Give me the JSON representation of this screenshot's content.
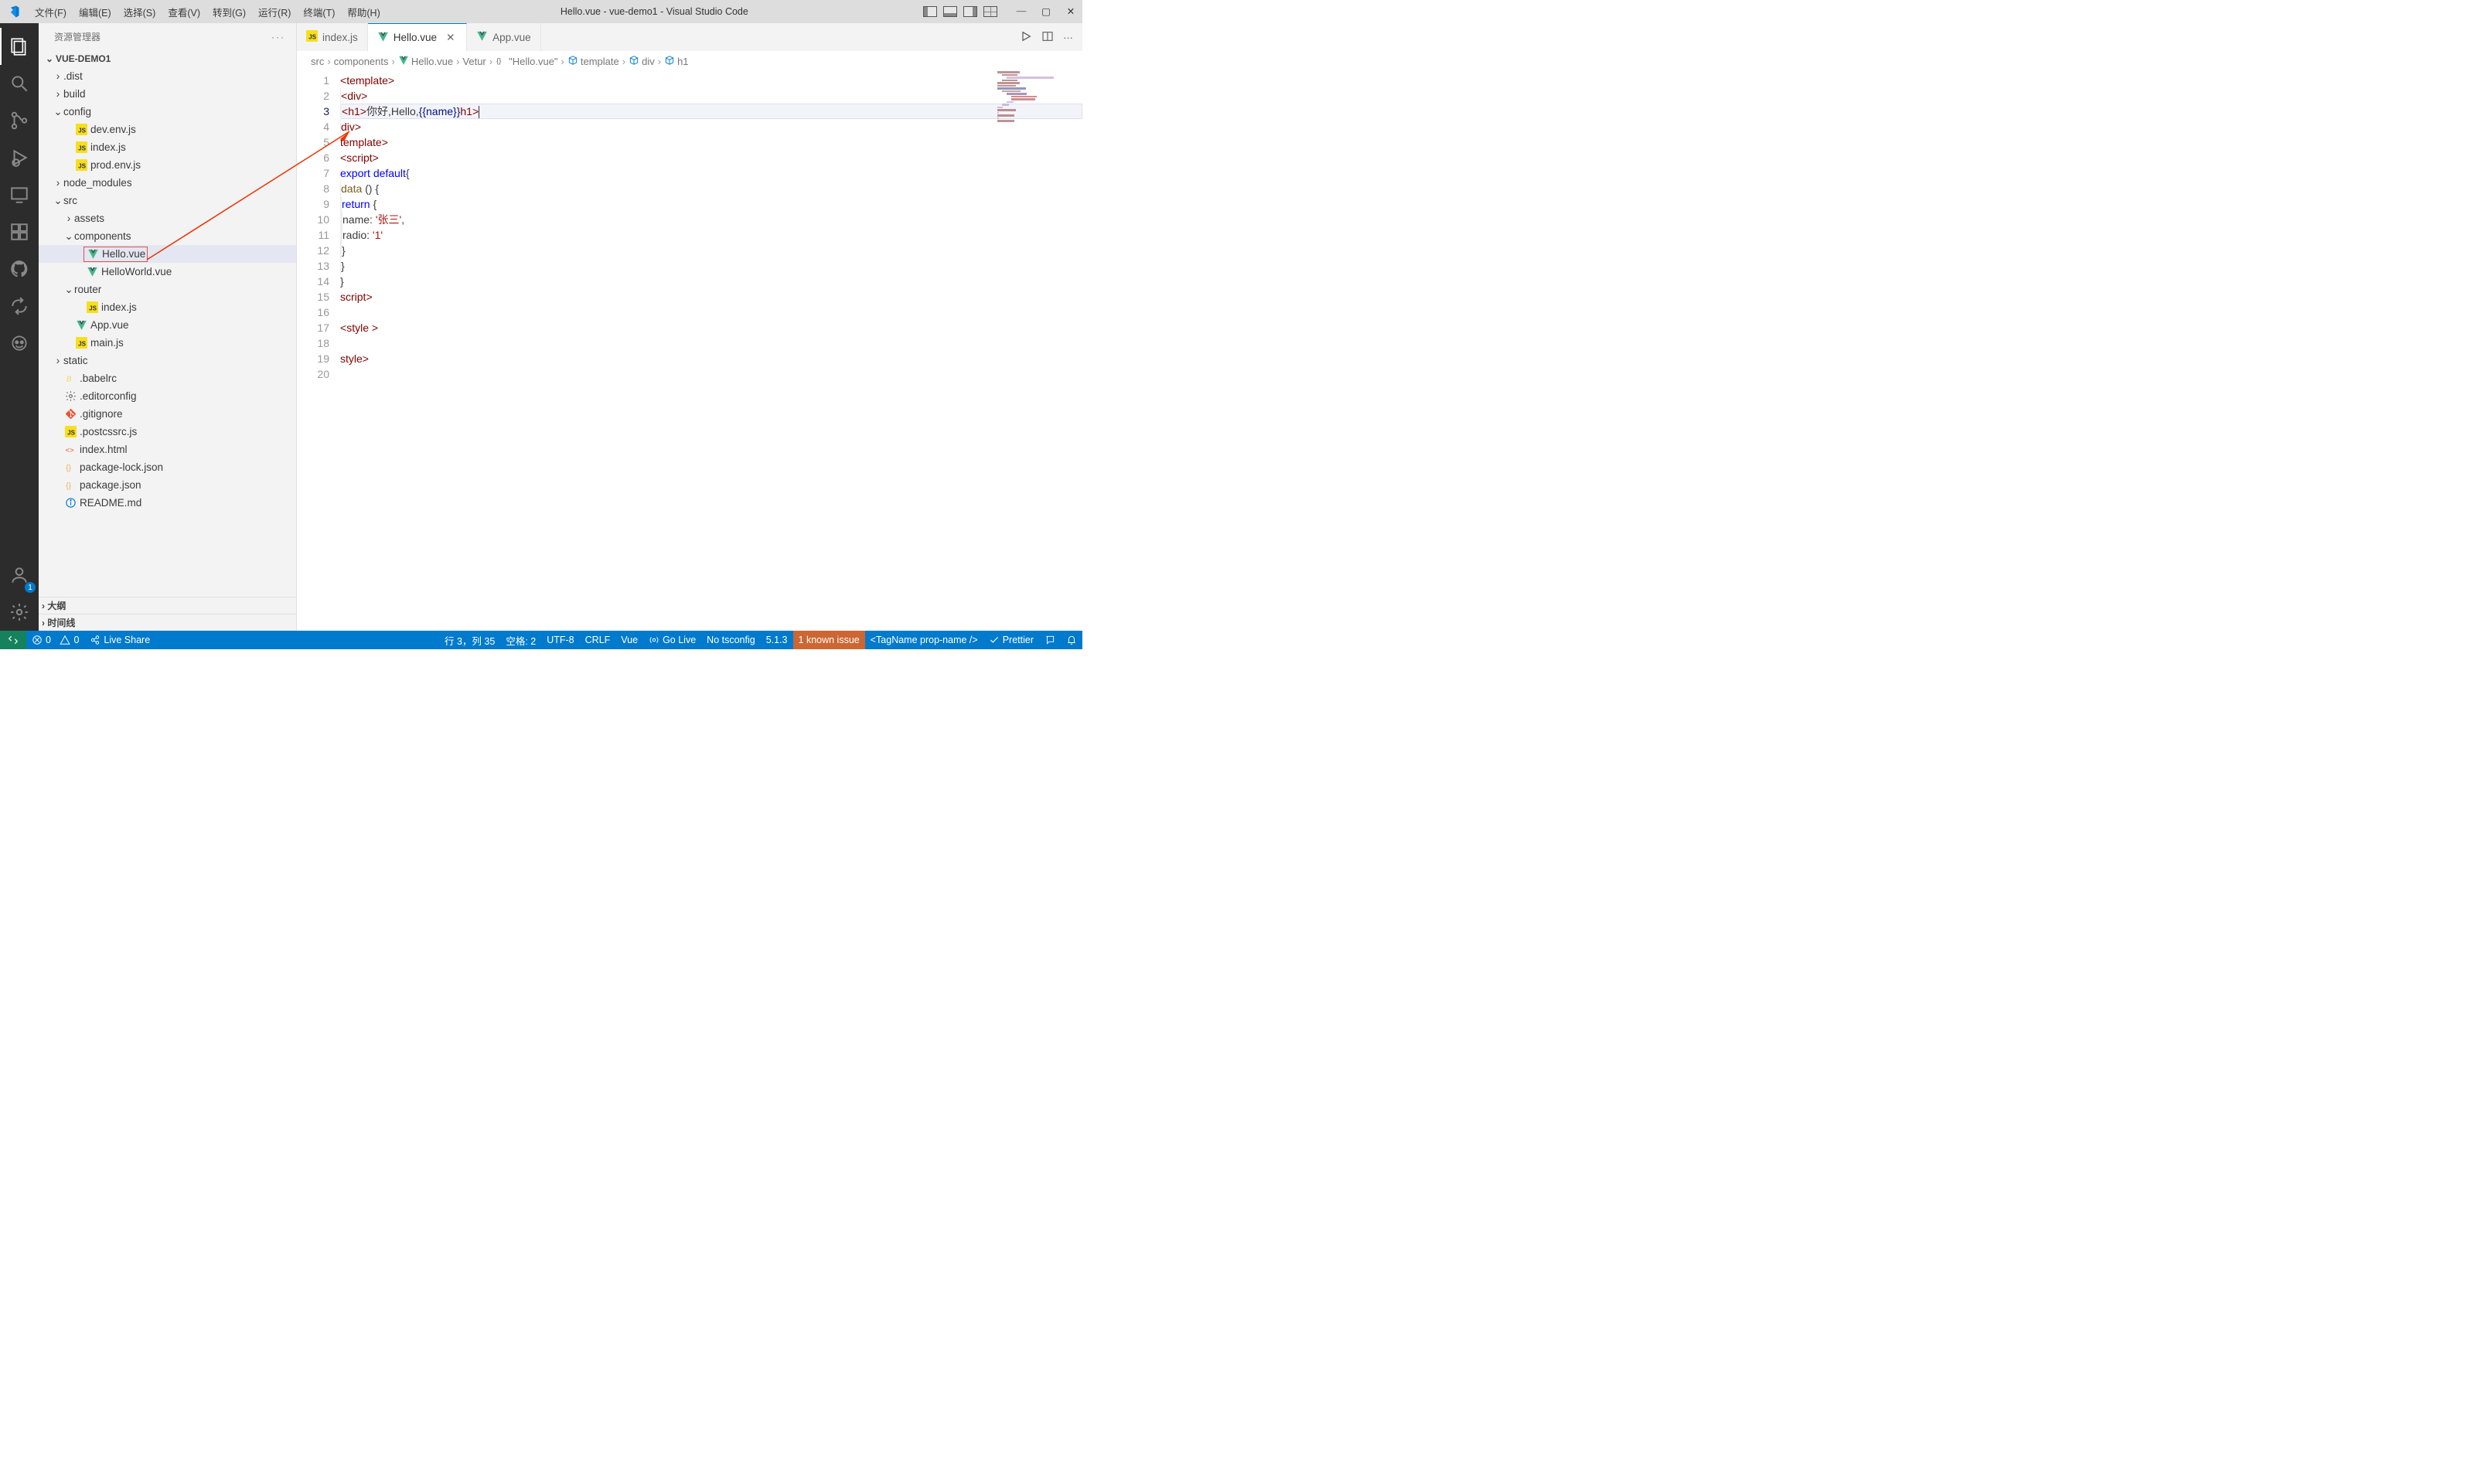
{
  "title": "Hello.vue - vue-demo1 - Visual Studio Code",
  "menus": [
    "文件(F)",
    "编辑(E)",
    "选择(S)",
    "查看(V)",
    "转到(G)",
    "运行(R)",
    "终端(T)",
    "帮助(H)"
  ],
  "sidebar_title": "资源管理器",
  "project_name": "VUE-DEMO1",
  "tree": [
    {
      "p": 1,
      "type": "folder",
      "open": false,
      "label": ".dist"
    },
    {
      "p": 1,
      "type": "folder",
      "open": false,
      "label": "build"
    },
    {
      "p": 1,
      "type": "folder",
      "open": true,
      "label": "config"
    },
    {
      "p": 2,
      "type": "file",
      "icon": "js",
      "label": "dev.env.js"
    },
    {
      "p": 2,
      "type": "file",
      "icon": "js",
      "label": "index.js"
    },
    {
      "p": 2,
      "type": "file",
      "icon": "js",
      "label": "prod.env.js"
    },
    {
      "p": 1,
      "type": "folder",
      "open": false,
      "label": "node_modules"
    },
    {
      "p": 1,
      "type": "folder",
      "open": true,
      "label": "src"
    },
    {
      "p": 2,
      "type": "folder",
      "open": false,
      "label": "assets"
    },
    {
      "p": 2,
      "type": "folder",
      "open": true,
      "label": "components"
    },
    {
      "p": 3,
      "type": "file",
      "icon": "vue",
      "label": "Hello.vue",
      "selected": true,
      "boxed": true
    },
    {
      "p": 3,
      "type": "file",
      "icon": "vue",
      "label": "HelloWorld.vue"
    },
    {
      "p": 2,
      "type": "folder",
      "open": true,
      "label": "router"
    },
    {
      "p": 3,
      "type": "file",
      "icon": "js",
      "label": "index.js"
    },
    {
      "p": 2,
      "type": "file",
      "icon": "vue",
      "label": "App.vue"
    },
    {
      "p": 2,
      "type": "file",
      "icon": "js",
      "label": "main.js"
    },
    {
      "p": 1,
      "type": "folder",
      "open": false,
      "label": "static"
    },
    {
      "p": 1,
      "type": "file",
      "icon": "babel",
      "label": ".babelrc"
    },
    {
      "p": 1,
      "type": "file",
      "icon": "gear",
      "label": ".editorconfig"
    },
    {
      "p": 1,
      "type": "file",
      "icon": "git",
      "label": ".gitignore"
    },
    {
      "p": 1,
      "type": "file",
      "icon": "js",
      "label": ".postcssrc.js"
    },
    {
      "p": 1,
      "type": "file",
      "icon": "html",
      "label": "index.html"
    },
    {
      "p": 1,
      "type": "file",
      "icon": "json",
      "label": "package-lock.json"
    },
    {
      "p": 1,
      "type": "file",
      "icon": "json",
      "label": "package.json"
    },
    {
      "p": 1,
      "type": "file",
      "icon": "info",
      "label": "README.md"
    }
  ],
  "panel_outline": "大纲",
  "panel_timeline": "时间线",
  "tabs": [
    {
      "icon": "js",
      "label": "index.js",
      "active": false
    },
    {
      "icon": "vue",
      "label": "Hello.vue",
      "active": true,
      "close": true
    },
    {
      "icon": "vue",
      "label": "App.vue",
      "active": false
    }
  ],
  "breadcrumb": [
    {
      "label": "src"
    },
    {
      "label": "components"
    },
    {
      "label": "Hello.vue",
      "icon": "vue"
    },
    {
      "label": "Vetur"
    },
    {
      "label": "\"Hello.vue\"",
      "icon": "braces"
    },
    {
      "label": "template",
      "icon": "cube"
    },
    {
      "label": "div",
      "icon": "cube"
    },
    {
      "label": "h1",
      "icon": "cube"
    }
  ],
  "code": {
    "line_count": 20,
    "current_line": 3,
    "lines": {
      "l1": {
        "open": "<",
        "tag": "template",
        "close": ">"
      },
      "l2": {
        "indent": 1,
        "open": "<",
        "tag": "div",
        "close": ">"
      },
      "l3": {
        "indent": 2,
        "open": "<",
        "tag": "h1",
        "close": ">",
        "t1": "你好,Hello,",
        "i1": "{{",
        "iname": "name",
        "i2": "}}",
        "copen": "</",
        "ctag": "h1",
        "cclose": ">"
      },
      "l4": {
        "indent": 1,
        "open": "</",
        "tag": "div",
        "close": ">"
      },
      "l5": {
        "open": "</",
        "tag": "template",
        "close": ">"
      },
      "l6": {
        "open": "<",
        "tag": "script",
        "close": ">"
      },
      "l7": {
        "kw1": "export",
        "kw2": "default",
        "brace": "{"
      },
      "l8": {
        "indent": 1,
        "fn": "data",
        "paren": " () {"
      },
      "l9": {
        "indent": 2,
        "kw": "return",
        "brace": " {"
      },
      "l10": {
        "indent": 3,
        "key": "name:",
        "val": "'张三'",
        "comma": ","
      },
      "l11": {
        "indent": 3,
        "key": "radio:",
        "val": "'1'"
      },
      "l12": {
        "indent": 2,
        "brace": "}"
      },
      "l13": {
        "indent": 1,
        "brace": "}"
      },
      "l14": {
        "brace": "}"
      },
      "l15": {
        "open": "</",
        "tag": "script",
        "close": ">"
      },
      "l17": {
        "open": "<",
        "tag": "style",
        "close": " >"
      },
      "l19": {
        "open": "</",
        "tag": "style",
        "close": ">"
      }
    }
  },
  "status": {
    "errors": "0",
    "warnings": "0",
    "live_share": "Live Share",
    "cursor": "行 3，列 35",
    "spaces": "空格: 2",
    "encoding": "UTF-8",
    "eol": "CRLF",
    "lang": "Vue",
    "go_live": "Go Live",
    "tsconfig": "No tsconfig",
    "version": "5.1.3",
    "known_issue": "1 known issue",
    "tag": "<TagName prop-name />",
    "prettier": "Prettier"
  },
  "account_badge": "1"
}
